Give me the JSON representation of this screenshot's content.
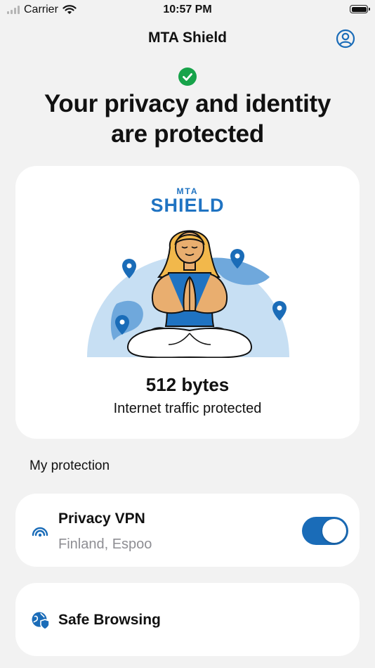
{
  "status_bar": {
    "carrier": "Carrier",
    "time": "10:57 PM"
  },
  "nav": {
    "title": "MTA Shield",
    "profile_icon": "profile-icon"
  },
  "status": {
    "icon": "check-circle-icon",
    "headline_line1": "Your privacy and identity",
    "headline_line2": "are protected",
    "color": "#17a34a"
  },
  "hero": {
    "brand_small": "MTA",
    "brand_big": "SHIELD",
    "brand_color": "#1f73c2",
    "traffic_value": "512 bytes",
    "traffic_label": "Internet traffic protected"
  },
  "protection": {
    "section_title": "My protection",
    "vpn": {
      "name": "Privacy VPN",
      "location": "Finland, Espoo",
      "enabled": true,
      "icon": "vpn-signal-icon"
    },
    "browsing": {
      "name": "Safe Browsing",
      "icon": "safe-browsing-globe-icon"
    }
  },
  "colors": {
    "accent": "#1a6cb8",
    "background": "#f2f2f2",
    "map_light": "#c7dff3",
    "map_dark": "#6fa8dc"
  }
}
